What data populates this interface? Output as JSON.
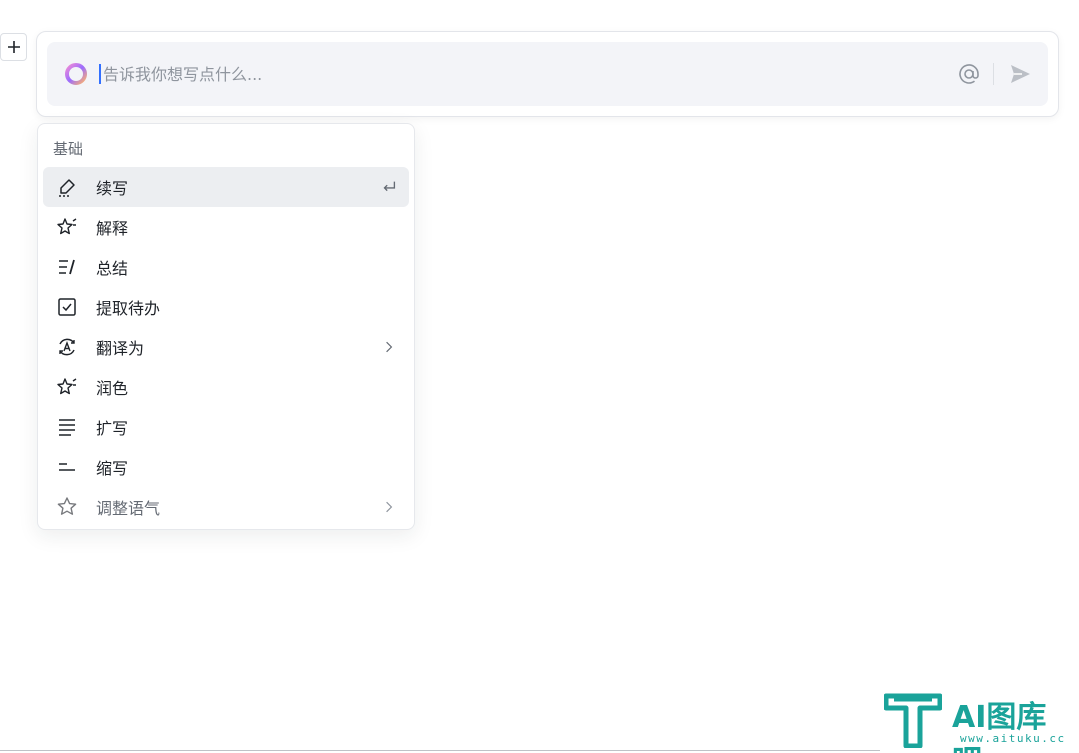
{
  "prompt": {
    "placeholder": "告诉我你想写点什么..."
  },
  "menu": {
    "header": "基础",
    "items": [
      {
        "label": "续写",
        "icon": "pencil-icon",
        "right": "enter-icon"
      },
      {
        "label": "解释",
        "icon": "sparkle-icon",
        "right": ""
      },
      {
        "label": "总结",
        "icon": "summary-icon",
        "right": ""
      },
      {
        "label": "提取待办",
        "icon": "checkbox-icon",
        "right": ""
      },
      {
        "label": "翻译为",
        "icon": "translate-icon",
        "right": "chevron-right-icon"
      },
      {
        "label": "润色",
        "icon": "sparkle-icon",
        "right": ""
      },
      {
        "label": "扩写",
        "icon": "expand-lines-icon",
        "right": ""
      },
      {
        "label": "缩写",
        "icon": "shorten-lines-icon",
        "right": ""
      },
      {
        "label": "调整语气",
        "icon": "star-outline-icon",
        "right": "chevron-right-icon"
      }
    ]
  },
  "watermark": {
    "brand": "AI图库吧",
    "url": "www.aituku.cc"
  },
  "colors": {
    "accent": "#3370ff",
    "brand": "#1aa39a"
  }
}
